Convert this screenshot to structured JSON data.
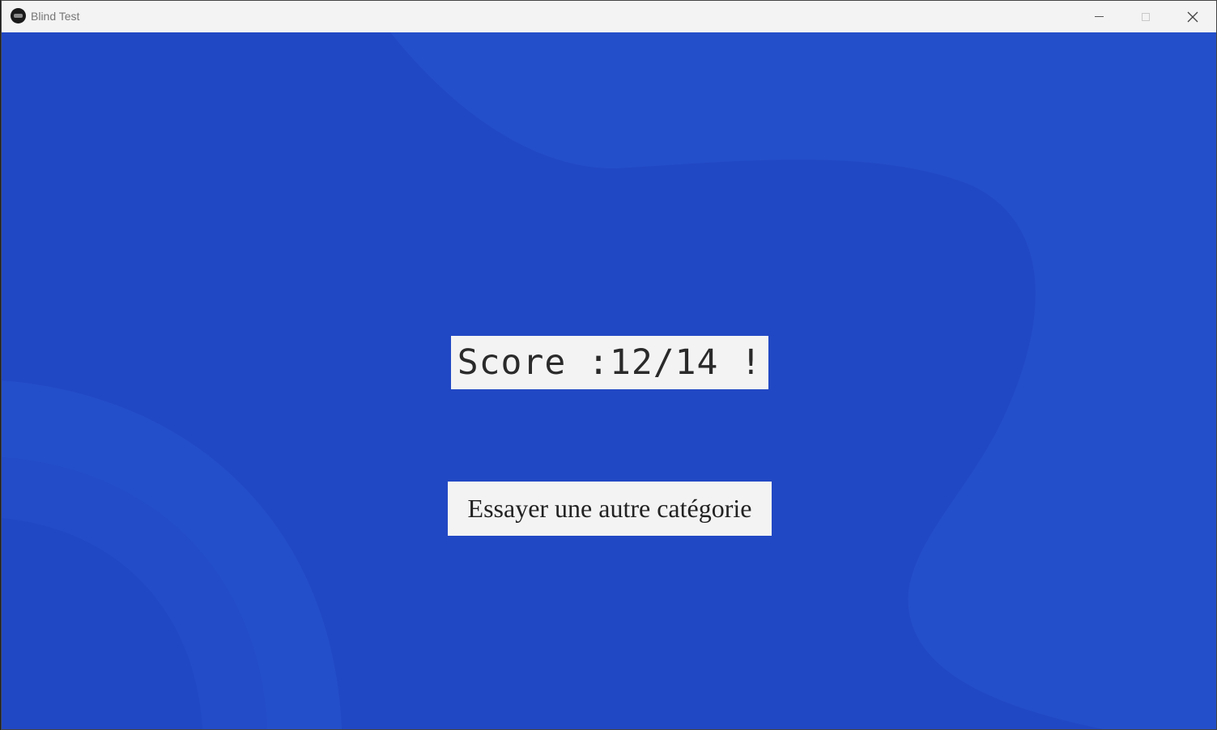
{
  "window": {
    "title": "Blind Test",
    "icon": "app-logo-icon",
    "controls": [
      "minimize-icon",
      "maximize-icon",
      "close-icon"
    ]
  },
  "main": {
    "score_text": "Score :12/14 !",
    "retry_button_label": "Essayer une autre catégorie"
  },
  "colors": {
    "background": "#2148c4",
    "background_shape": "#244fca",
    "panel": "#f3f3f3",
    "text": "#222222"
  }
}
